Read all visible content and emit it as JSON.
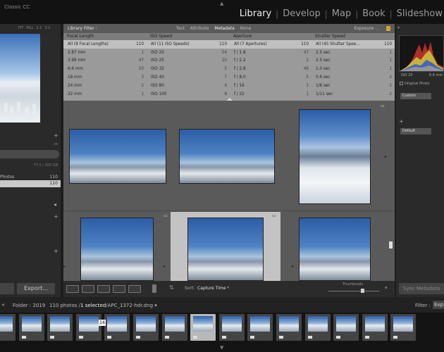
{
  "app": {
    "name": "Classic CC"
  },
  "modules": [
    "Library",
    "Develop",
    "Map",
    "Book",
    "Slideshow"
  ],
  "active_module": "Library",
  "left_panel": {
    "nav_zoom": [
      "FIT",
      "FILL",
      "1:1",
      "3:1"
    ],
    "storage": "77.5 / 300 GB",
    "photos_label": "Photos",
    "photos_count": "110",
    "selected_count": "110",
    "export_label": "Export..."
  },
  "library_filter": {
    "title": "Library Filter :",
    "tabs": [
      "Text",
      "Attribute",
      "Metadata",
      "None"
    ],
    "active_tab": "Metadata",
    "presets": "Exposure ...",
    "columns": [
      {
        "header": "Focal Length",
        "rows": [
          {
            "label": "All (8 Focal Lengths)",
            "count": "110"
          },
          {
            "label": "2.87 mm",
            "count": "1"
          },
          {
            "label": "3.99 mm",
            "count": "47"
          },
          {
            "label": "6.6 mm",
            "count": "10"
          },
          {
            "label": "18 mm",
            "count": "3"
          },
          {
            "label": "24 mm",
            "count": "2"
          },
          {
            "label": "32 mm",
            "count": "1"
          }
        ]
      },
      {
        "header": "ISO Speed",
        "rows": [
          {
            "label": "All (11 ISO Speeds)",
            "count": "110"
          },
          {
            "label": "ISO 20",
            "count": "54"
          },
          {
            "label": "ISO 25",
            "count": "20"
          },
          {
            "label": "ISO 32",
            "count": "5"
          },
          {
            "label": "ISO 40",
            "count": "7"
          },
          {
            "label": "ISO 80",
            "count": "4"
          },
          {
            "label": "ISO 100",
            "count": "8"
          }
        ]
      },
      {
        "header": "Aperture",
        "rows": [
          {
            "label": "All (7 Apertures)",
            "count": "110"
          },
          {
            "label": "f / 1.8",
            "count": "47"
          },
          {
            "label": "f / 2.2",
            "count": "2"
          },
          {
            "label": "f / 2.8",
            "count": "46"
          },
          {
            "label": "f / 8.0",
            "count": "5"
          },
          {
            "label": "f / 16",
            "count": "1"
          },
          {
            "label": "f / 22",
            "count": "1"
          }
        ]
      },
      {
        "header": "Shutter Speed",
        "rows": [
          {
            "label": "All (45 Shutter Spee...",
            "count": "110"
          },
          {
            "label": "2.5 sec",
            "count": "1"
          },
          {
            "label": "2.5 sec",
            "count": "1"
          },
          {
            "label": "1.0 sec",
            "count": "1"
          },
          {
            "label": "0.6 sec",
            "count": "2"
          },
          {
            "label": "1/6 sec",
            "count": "1"
          },
          {
            "label": "1/11 sec",
            "count": "2"
          }
        ]
      }
    ]
  },
  "toolbar": {
    "sort_label": "Sort:",
    "sort_value": "Capture Time",
    "thumbnails_label": "Thumbnails"
  },
  "right_panel": {
    "iso": "ISO 20",
    "focal": "6.6 mm",
    "original_photo": "Original Photo",
    "custom_label": "Custom",
    "default_label": "Default",
    "sync_label": "Sync Metadata"
  },
  "filmstrip_bar": {
    "folder": "Folder : 2019",
    "count_prefix": "110 photos /",
    "selected": "1 selected",
    "filename": "/APC_1372-hdr.dng",
    "filter_label": "Filter :",
    "filter_value": "Exp"
  },
  "filmstrip": {
    "badge_number": "14",
    "thumb_count": 15,
    "selected_index": 7
  },
  "colors": {
    "accent_lock": "#d5a032",
    "filter_panel": "#9a9a9a",
    "grid_bg": "#5a5a5a"
  }
}
